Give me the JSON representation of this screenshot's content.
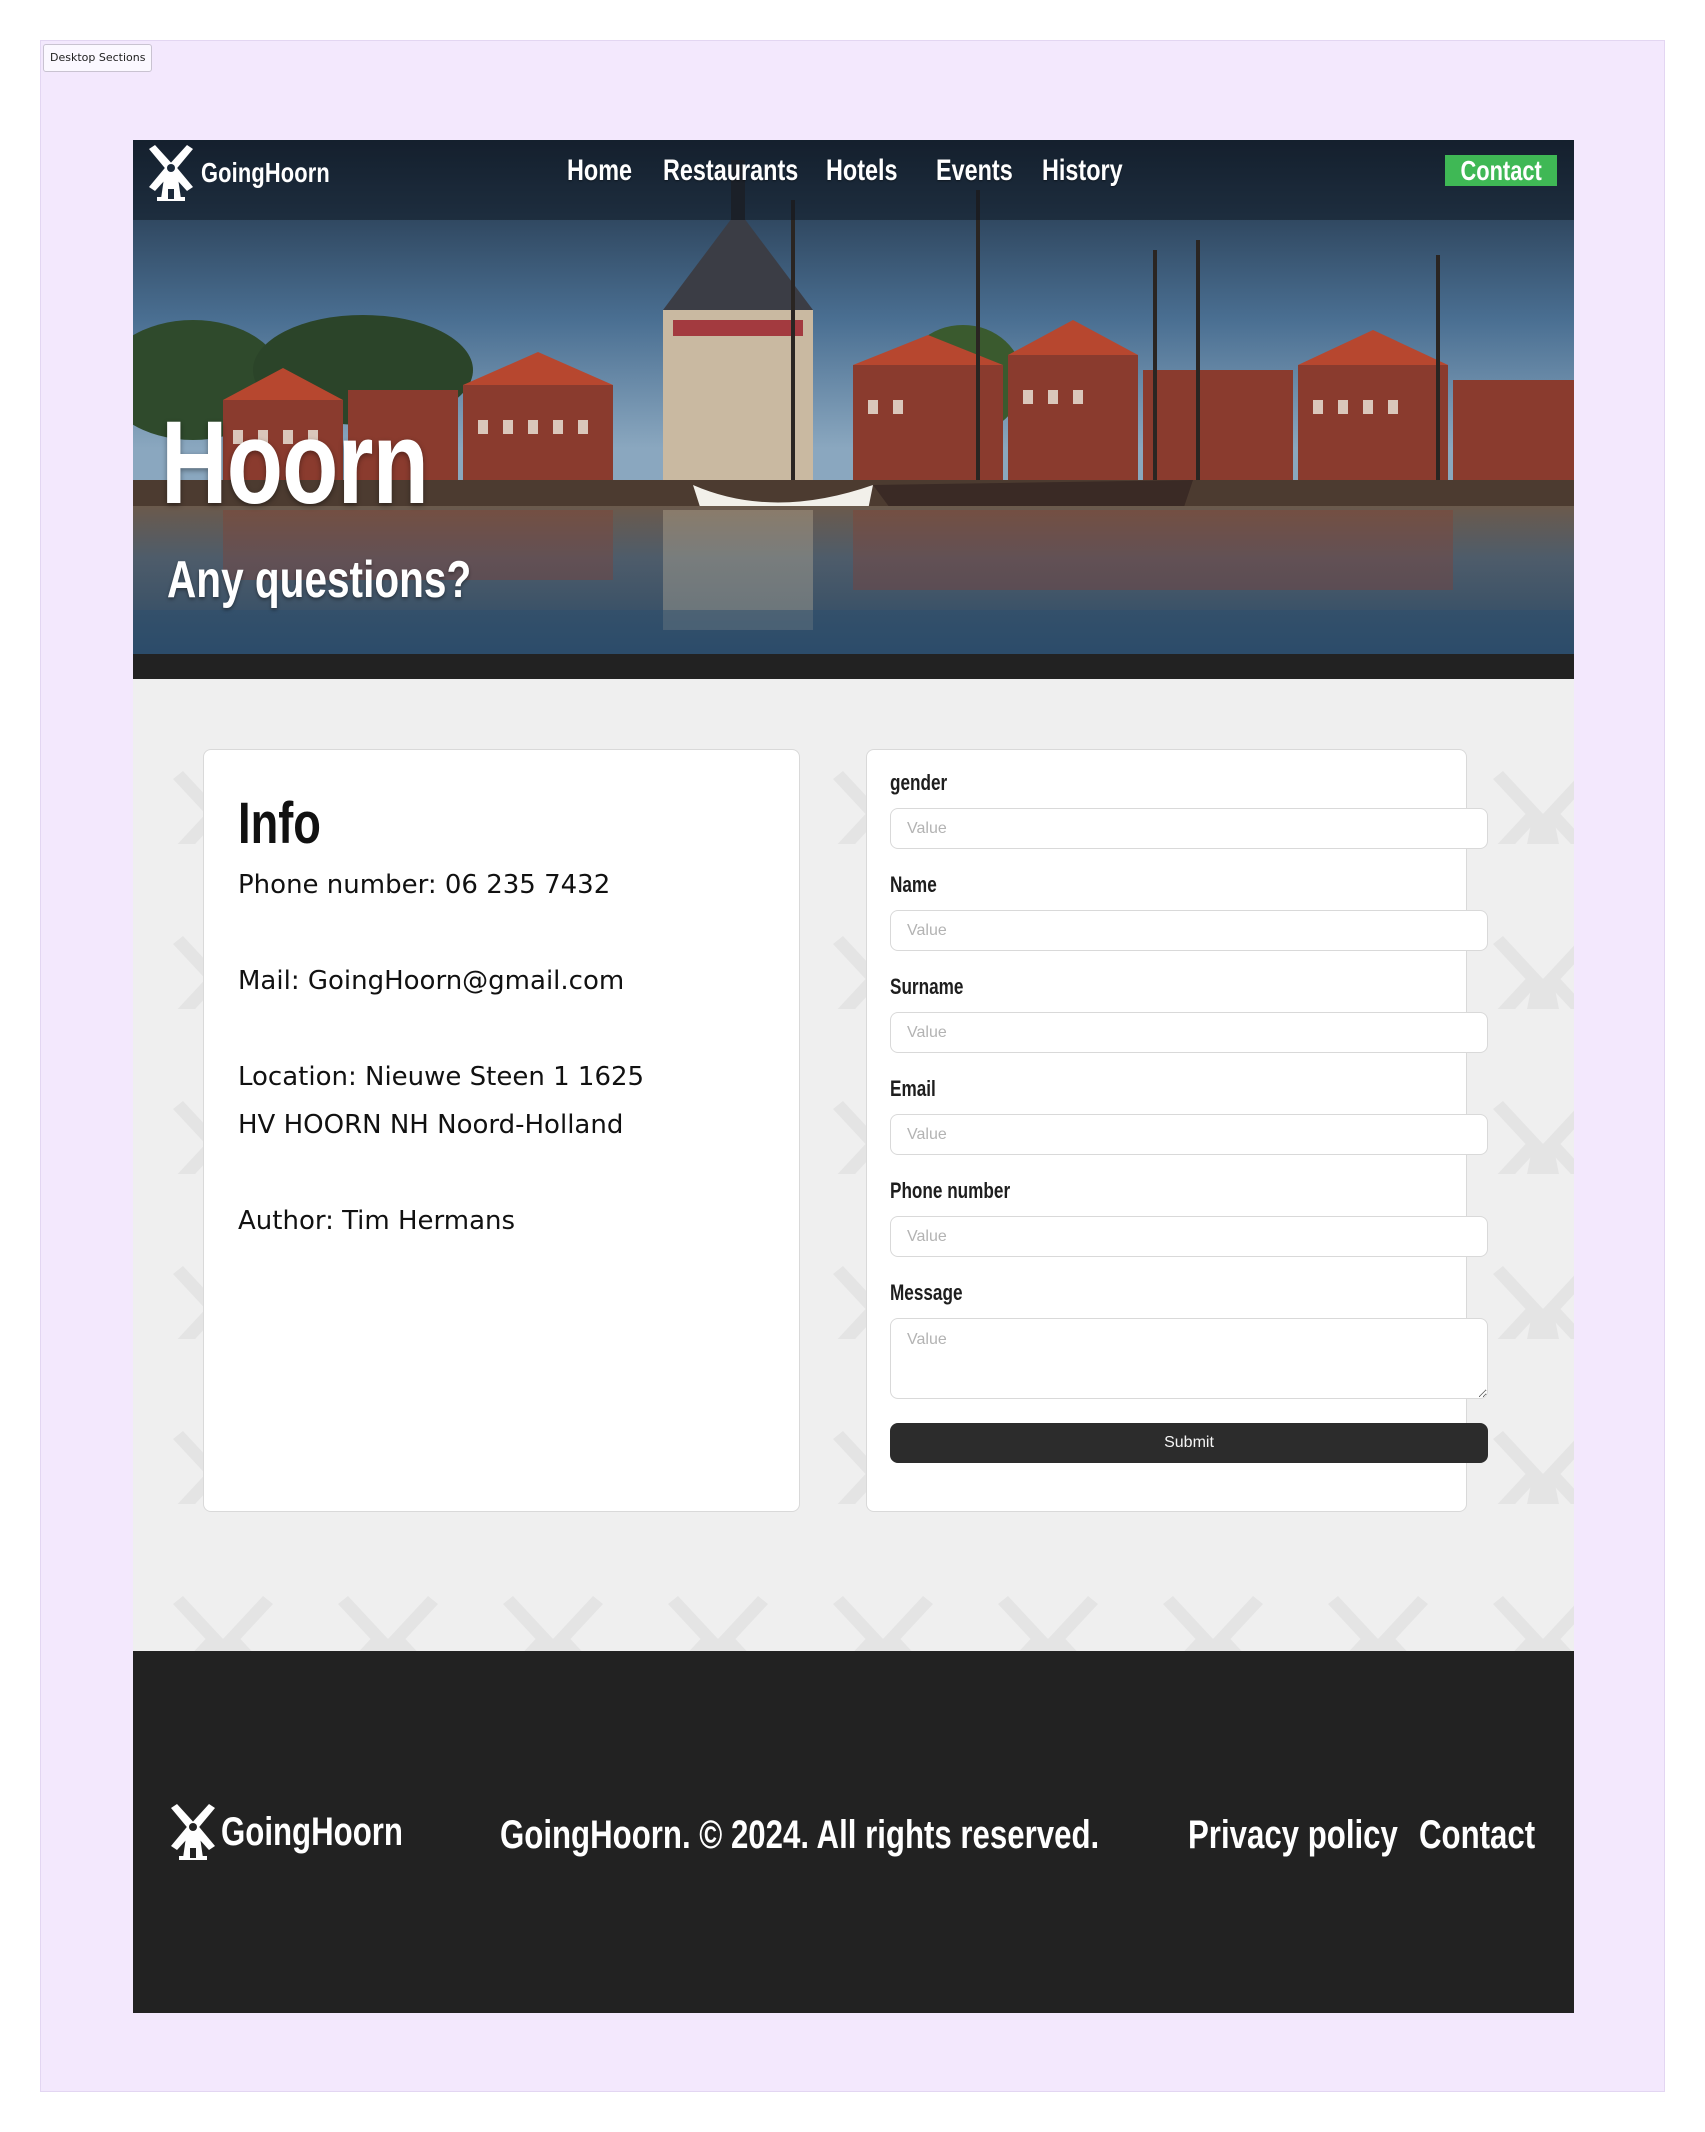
{
  "canvas": {
    "section_tag": "Desktop Sections"
  },
  "nav": {
    "brand": "GoingHoorn",
    "links": [
      "Home",
      "Restaurants",
      "Hotels",
      "Events",
      "History"
    ],
    "contact_label": "Contact",
    "contact_color": "#3fb855"
  },
  "hero": {
    "title": "Hoorn",
    "subtitle": "Any questions?"
  },
  "info": {
    "title": "Info",
    "phone": "Phone number: 06 235 7432",
    "mail": "Mail: GoingHoorn@gmail.com",
    "location_line1": "Location: Nieuwe Steen 1 1625",
    "location_line2": "HV HOORN NH Noord-Holland",
    "author": "Author: Tim Hermans"
  },
  "form": {
    "fields": [
      {
        "label": "gender",
        "placeholder": "Value"
      },
      {
        "label": "Name",
        "placeholder": "Value"
      },
      {
        "label": "Surname",
        "placeholder": "Value"
      },
      {
        "label": "Email",
        "placeholder": "Value"
      },
      {
        "label": "Phone number",
        "placeholder": "Value"
      }
    ],
    "message": {
      "label": "Message",
      "placeholder": "Value"
    },
    "submit_label": "Submit"
  },
  "footer": {
    "brand": "GoingHoorn",
    "copyright": "GoingHoorn. © 2024. All rights reserved.",
    "privacy_label": "Privacy policy",
    "contact_label": "Contact",
    "background": "#222222"
  },
  "icons": {
    "logo": "windmill-icon"
  }
}
